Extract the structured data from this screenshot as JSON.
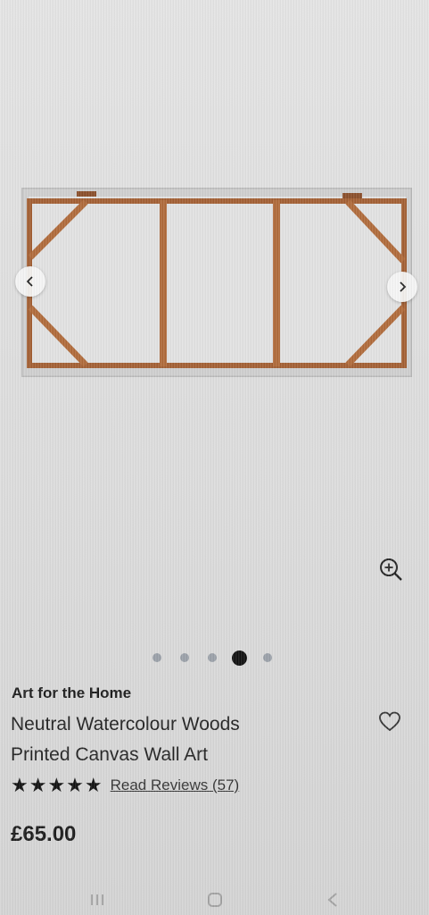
{
  "product": {
    "brand": "Art for the Home",
    "title_line1": "Neutral Watercolour Woods",
    "title_line2": "Printed Canvas Wall Art",
    "stars": "★★★★★",
    "rating_value": 5,
    "reviews_label": "Read Reviews (57)",
    "price": "£65.00"
  },
  "gallery": {
    "image_count": 5,
    "active_index": 3,
    "prev_icon": "chevron-left-icon",
    "next_icon": "chevron-right-icon",
    "zoom_icon": "zoom-in-icon"
  },
  "colors": {
    "frame_wood": "#b06a3a",
    "dot_active": "#111111",
    "dot_inactive": "#9aa0a8"
  },
  "system_nav": [
    "recent-apps-icon",
    "home-icon",
    "back-icon"
  ]
}
